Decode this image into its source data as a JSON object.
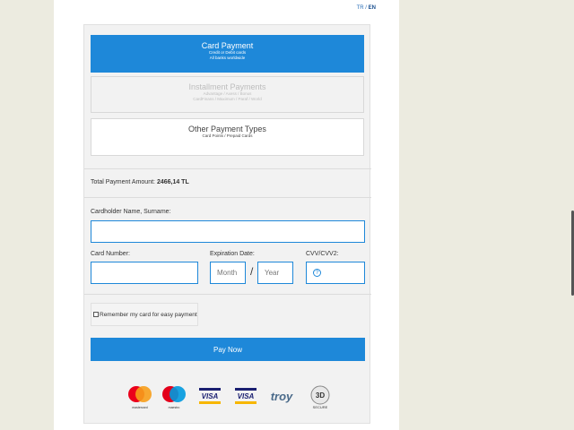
{
  "lang": {
    "tr": "TR",
    "sep": " / ",
    "en": "EN"
  },
  "options": {
    "card": {
      "title": "Card Payment",
      "sub1": "Credit or Debit cards",
      "sub2": "All banks worldwide"
    },
    "installment": {
      "title": "Installment Payments",
      "sub1": "Advantage / Axess / Bonus",
      "sub2": "CardFinans / Maximum / Paraf / World"
    },
    "other": {
      "title": "Other Payment Types",
      "sub1": "Card Points / Prepaid Cards"
    }
  },
  "amount": {
    "label": "Total Payment Amount:",
    "value": "2466,14 TL"
  },
  "form": {
    "holder_label": "Cardholder Name, Surname:",
    "holder_value": "",
    "number_label": "Card Number:",
    "number_value": "",
    "exp_label": "Expiration Date:",
    "month_placeholder": "Month",
    "slash": "/",
    "year_placeholder": "Year",
    "cvv_label": "CVV/CVV2:",
    "cvv_help": "?"
  },
  "remember_label": "Remember my card for easy payment",
  "pay_label": "Pay Now",
  "logos": {
    "mastercard": "mastercard",
    "maestro": "maestro",
    "visa1": "VISA",
    "visa2": "VISA",
    "troy": "troy",
    "secure_3d": "3D",
    "secure_text": "SECURE"
  },
  "colors": {
    "accent": "#1e88d9",
    "background": "#ecebe0"
  }
}
